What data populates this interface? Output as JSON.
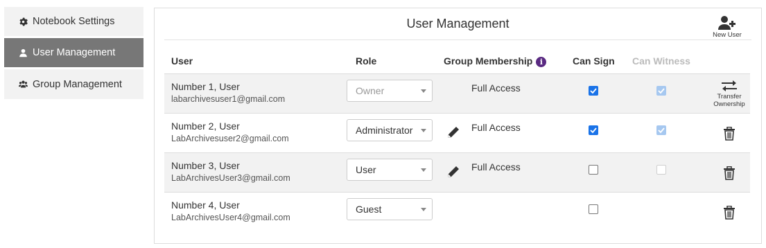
{
  "sidebar": {
    "items": [
      {
        "label": "Notebook Settings",
        "icon": "gear-icon",
        "active": false
      },
      {
        "label": "User Management",
        "icon": "user-icon",
        "active": true
      },
      {
        "label": "Group Management",
        "icon": "users-icon",
        "active": false
      }
    ]
  },
  "panel": {
    "title": "User Management",
    "new_user_label": "New User"
  },
  "table": {
    "headers": {
      "user": "User",
      "role": "Role",
      "group_membership": "Group Membership",
      "can_sign": "Can Sign",
      "can_witness": "Can Witness"
    },
    "rows": [
      {
        "name": "Number 1, User",
        "email": "labarchivesuser1@gmail.com",
        "role": "Owner",
        "role_disabled": true,
        "membership": "Full Access",
        "editable_membership": false,
        "can_sign": true,
        "can_witness": true,
        "action_label": "Transfer Ownership",
        "action_line1": "Transfer",
        "action_line2": "Ownership"
      },
      {
        "name": "Number 2, User",
        "email": "LabArchivesuser2@gmail.com",
        "role": "Administrator",
        "role_disabled": false,
        "membership": "Full Access",
        "editable_membership": true,
        "can_sign": true,
        "can_witness": true,
        "action_label": "delete"
      },
      {
        "name": "Number 3, User",
        "email": "LabArchivesUser3@gmail.com",
        "role": "User",
        "role_disabled": false,
        "membership": "Full Access",
        "editable_membership": true,
        "can_sign": false,
        "can_witness": false,
        "action_label": "delete"
      },
      {
        "name": "Number 4, User",
        "email": "LabArchivesUser4@gmail.com",
        "role": "Guest",
        "role_disabled": false,
        "membership": "",
        "editable_membership": false,
        "can_sign": false,
        "can_witness": null,
        "action_label": "delete"
      }
    ]
  },
  "colors": {
    "active_sidebar": "#777777",
    "checkbox_checked": "#1a73e8",
    "info_icon": "#5a2a82"
  }
}
